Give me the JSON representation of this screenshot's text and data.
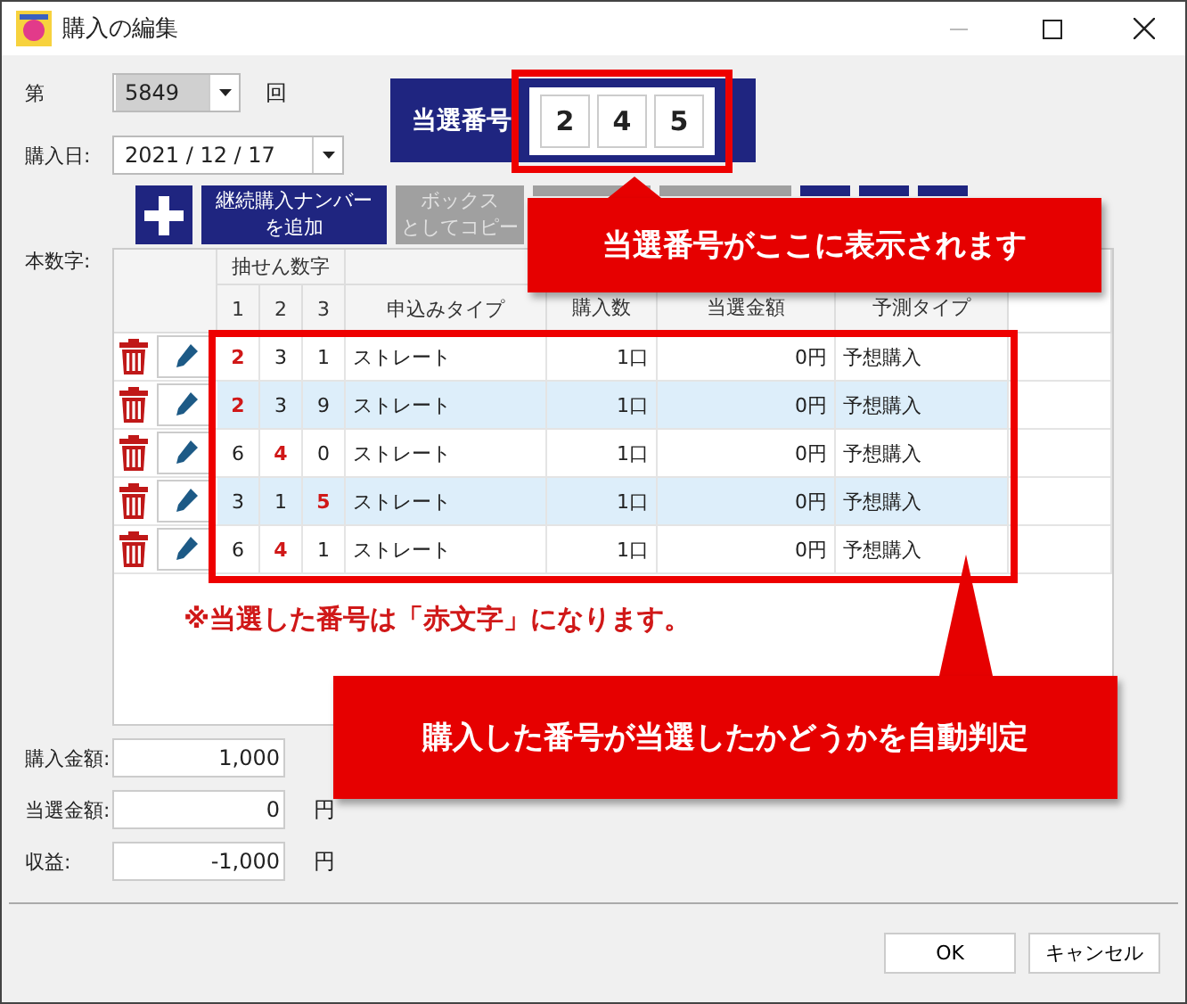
{
  "window": {
    "title": "購入の編集"
  },
  "draw": {
    "prefix": "第",
    "number": "5849",
    "suffix": "回"
  },
  "winning_numbers": {
    "label": "当選番号",
    "digits": [
      "2",
      "4",
      "5"
    ]
  },
  "purchase_date": {
    "label": "購入日:",
    "value": "2021 / 12 / 17"
  },
  "toolbar": [
    {
      "kind": "add",
      "disabled": false
    },
    {
      "kind": "text",
      "lines": [
        "継続購入ナンバー",
        "を追加"
      ],
      "disabled": false
    },
    {
      "kind": "text",
      "lines": [
        "ボックス",
        "としてコピー"
      ],
      "disabled": true
    },
    {
      "kind": "blank",
      "disabled": true
    },
    {
      "kind": "blank",
      "disabled": true
    },
    {
      "kind": "blank",
      "disabled": false
    },
    {
      "kind": "blank",
      "disabled": false
    },
    {
      "kind": "blank",
      "disabled": false
    }
  ],
  "main_label": "本数字:",
  "table": {
    "group_header": "抽せん数字",
    "columns": [
      "1",
      "2",
      "3",
      "申込みタイプ",
      "購入数",
      "当選金額",
      "予測タイプ"
    ],
    "rows": [
      {
        "digits": [
          {
            "value": "2",
            "winning": true
          },
          {
            "value": "3",
            "winning": false
          },
          {
            "value": "1",
            "winning": false
          }
        ],
        "type": "ストレート",
        "quantity": "1口",
        "prize": "0円",
        "prediction": "予想購入"
      },
      {
        "digits": [
          {
            "value": "2",
            "winning": true
          },
          {
            "value": "3",
            "winning": false
          },
          {
            "value": "9",
            "winning": false
          }
        ],
        "type": "ストレート",
        "quantity": "1口",
        "prize": "0円",
        "prediction": "予想購入"
      },
      {
        "digits": [
          {
            "value": "6",
            "winning": false
          },
          {
            "value": "4",
            "winning": true
          },
          {
            "value": "0",
            "winning": false
          }
        ],
        "type": "ストレート",
        "quantity": "1口",
        "prize": "0円",
        "prediction": "予想購入"
      },
      {
        "digits": [
          {
            "value": "3",
            "winning": false
          },
          {
            "value": "1",
            "winning": false
          },
          {
            "value": "5",
            "winning": true
          }
        ],
        "type": "ストレート",
        "quantity": "1口",
        "prize": "0円",
        "prediction": "予想購入"
      },
      {
        "digits": [
          {
            "value": "6",
            "winning": false
          },
          {
            "value": "4",
            "winning": true
          },
          {
            "value": "1",
            "winning": false
          }
        ],
        "type": "ストレート",
        "quantity": "1口",
        "prize": "0円",
        "prediction": "予想購入"
      }
    ]
  },
  "summary": [
    {
      "label": "購入金額:",
      "value": "1,000"
    },
    {
      "label": "当選金額:",
      "value": "0",
      "unit": "円"
    },
    {
      "label": "収益:",
      "value": "-1,000",
      "unit": "円"
    }
  ],
  "buttons": [
    "OK",
    "キャンセル"
  ],
  "annotations": {
    "note": "※当選した番号は「赤文字」になります。",
    "callouts": [
      "当選番号がここに表示されます",
      "購入した番号が当選したかどうかを自動判定"
    ]
  }
}
